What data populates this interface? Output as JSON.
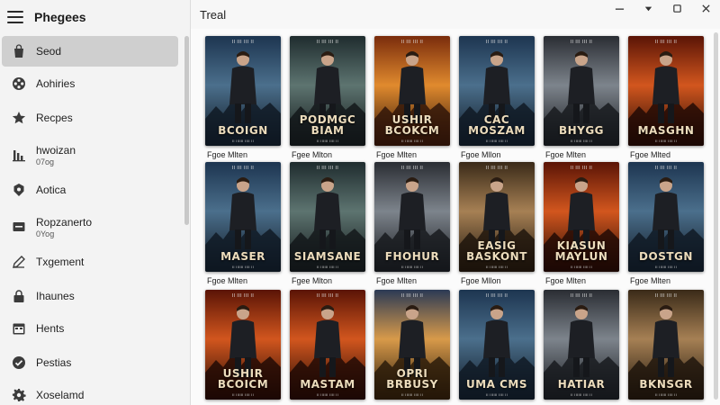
{
  "app": {
    "title": "Phegees"
  },
  "sidebar": {
    "items": [
      {
        "label": "Seod",
        "sub": "",
        "icon": "bag-icon",
        "active": true
      },
      {
        "label": "Aohiries",
        "sub": "",
        "icon": "film-reel-icon",
        "active": false
      },
      {
        "label": "Recpes",
        "sub": "",
        "icon": "star-icon",
        "active": false
      },
      {
        "label": "hwoizan",
        "sub": "07og",
        "icon": "bar-chart-icon",
        "active": false
      },
      {
        "label": "Aotica",
        "sub": "",
        "icon": "badge-icon",
        "active": false
      },
      {
        "label": "Ropzanerto",
        "sub": "0Yog",
        "icon": "inbox-icon",
        "active": false
      },
      {
        "label": "Txgement",
        "sub": "",
        "icon": "edit-icon",
        "active": false
      },
      {
        "label": "Ihaunes",
        "sub": "",
        "icon": "lock-icon",
        "active": false
      },
      {
        "label": "Hents",
        "sub": "",
        "icon": "calendar-icon",
        "active": false
      },
      {
        "label": "Pestias",
        "sub": "",
        "icon": "check-circle-icon",
        "active": false
      },
      {
        "label": "Xoselamd",
        "sub": "",
        "icon": "gear-icon",
        "active": false
      }
    ]
  },
  "main": {
    "title": "Treal",
    "window_controls": [
      "minimize-icon",
      "dropdown-icon",
      "maximize-icon",
      "close-icon"
    ],
    "posters": [
      {
        "title": "BCOIGN",
        "caption": "Fgoe Mlten",
        "palette": "blue"
      },
      {
        "title": "PODMGC BIAM",
        "caption": "Fgee Mlton",
        "palette": "teal"
      },
      {
        "title": "USHIR BCOKCM",
        "caption": "Fgoe Mlten",
        "palette": "orange"
      },
      {
        "title": "CAC MOSZAM",
        "caption": "Fgoe Mllon",
        "palette": "blue"
      },
      {
        "title": "BHYGG",
        "caption": "Fgoe Mlten",
        "palette": "gray"
      },
      {
        "title": "MASGHN",
        "caption": "Fgoe Mlted",
        "palette": "fire"
      },
      {
        "title": "MASER",
        "caption": "Fgoe Mlten",
        "palette": "blue"
      },
      {
        "title": "SIAMSANE",
        "caption": "Fgee Mlton",
        "palette": "teal"
      },
      {
        "title": "FHOHUR",
        "caption": "Fgoe Mlten",
        "palette": "gray"
      },
      {
        "title": "EASIG BASKONT",
        "caption": "Fgoe Mllon",
        "palette": "sepia"
      },
      {
        "title": "KIASUN MAYLUN",
        "caption": "Fgoe Mlten",
        "palette": "fire"
      },
      {
        "title": "DOSTGN",
        "caption": "Fgoe Mlten",
        "palette": "blue"
      },
      {
        "title": "USHIR BCOICM",
        "caption": "",
        "palette": "fire"
      },
      {
        "title": "MASTAM",
        "caption": "",
        "palette": "fire"
      },
      {
        "title": "OPRI BRBUSY",
        "caption": "",
        "palette": "sunset"
      },
      {
        "title": "UMA CMS",
        "caption": "",
        "palette": "blue"
      },
      {
        "title": "HATIAR",
        "caption": "",
        "palette": "gray"
      },
      {
        "title": "BKNSGR",
        "caption": "",
        "palette": "sepia"
      }
    ]
  }
}
